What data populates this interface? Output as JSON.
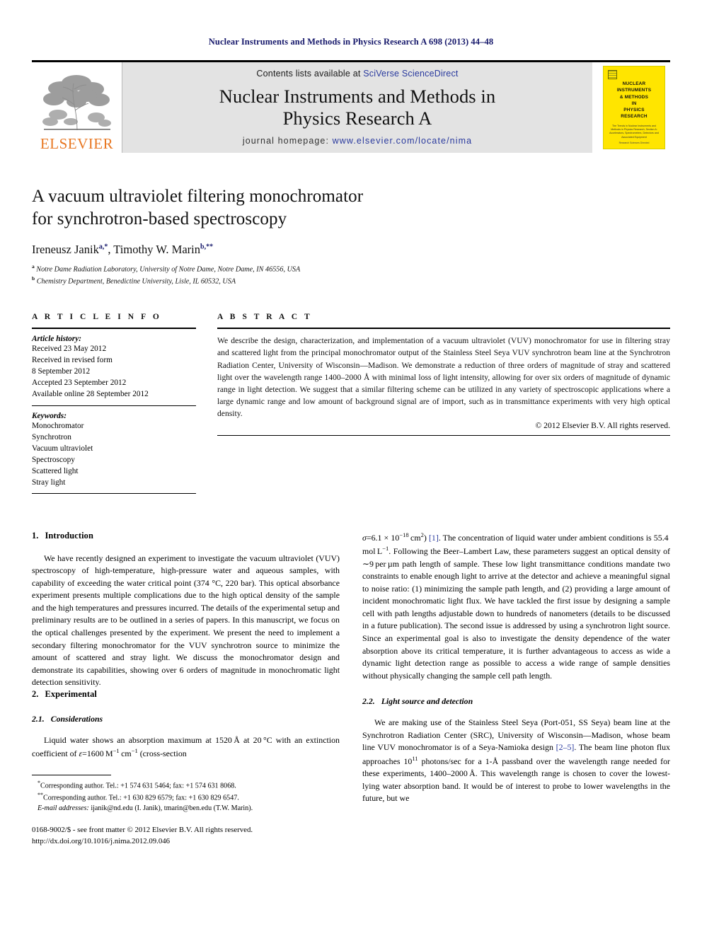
{
  "running_head": "Nuclear Instruments and Methods in Physics Research A 698 (2013) 44–48",
  "masthead": {
    "publisher_name": "ELSEVIER",
    "contents_prefix": "Contents lists available at ",
    "contents_link": "SciVerse ScienceDirect",
    "journal_title_line1": "Nuclear Instruments and Methods in",
    "journal_title_line2": "Physics Research A",
    "homepage_prefix": "journal homepage: ",
    "homepage_link": "www.elsevier.com/locate/nima",
    "cover": {
      "title_lines": [
        "NUCLEAR",
        "INSTRUMENTS",
        "& METHODS",
        "IN",
        "PHYSICS",
        "RESEARCH"
      ],
      "subtitle": "The Trends in Nuclear Instruments and Methods in Physics Research, Section A: Accelerators, Spectrometers, Detectors and Associated Equipment",
      "footer": "Research Sciences Directed"
    }
  },
  "article": {
    "title_line1": "A vacuum ultraviolet filtering monochromator",
    "title_line2": "for synchrotron-based spectroscopy",
    "authors_html": "Ireneusz Janik<sup>a,*</sup>, Timothy W. Marin<sup>b,**</sup>",
    "affiliation_a_marker": "a",
    "affiliation_a": "Notre Dame Radiation Laboratory, University of Notre Dame, Notre Dame, IN 46556, USA",
    "affiliation_b_marker": "b",
    "affiliation_b": "Chemistry Department, Benedictine University, Lisle, IL 60532, USA"
  },
  "article_info": {
    "heading": "A R T I C L E   I N F O",
    "history_label": "Article history:",
    "history": [
      "Received 23 May 2012",
      "Received in revised form",
      "8 September 2012",
      "Accepted 23 September 2012",
      "Available online 28 September 2012"
    ],
    "keywords_label": "Keywords:",
    "keywords": [
      "Monochromator",
      "Synchrotron",
      "Vacuum ultraviolet",
      "Spectroscopy",
      "Scattered light",
      "Stray light"
    ]
  },
  "abstract": {
    "heading": "A B S T R A C T",
    "text": "We describe the design, characterization, and implementation of a vacuum ultraviolet (VUV) monochromator for use in filtering stray and scattered light from the principal monochromator output of the Stainless Steel Seya VUV synchrotron beam line at the Synchrotron Radiation Center, University of Wisconsin—Madison. We demonstrate a reduction of three orders of magnitude of stray and scattered light over the wavelength range 1400–2000 Å with minimal loss of light intensity, allowing for over six orders of magnitude of dynamic range in light detection. We suggest that a similar filtering scheme can be utilized in any variety of spectroscopic applications where a large dynamic range and low amount of background signal are of import, such as in transmittance experiments with very high optical density.",
    "copyright": "© 2012 Elsevier B.V. All rights reserved."
  },
  "sections": {
    "intro_num": "1.",
    "intro_title": "Introduction",
    "intro_para": "We have recently designed an experiment to investigate the vacuum ultraviolet (VUV) spectroscopy of high-temperature, high-pressure water and aqueous samples, with capability of exceeding the water critical point (374 °C, 220 bar). This optical absorbance experiment presents multiple complications due to the high optical density of the sample and the high temperatures and pressures incurred. The details of the experimental setup and preliminary results are to be outlined in a series of papers. In this manuscript, we focus on the optical challenges presented by the experiment. We present the need to implement a secondary filtering monochromator for the VUV synchrotron source to minimize the amount of scattered and stray light. We discuss the monochromator design and demonstrate its capabilities, showing over 6 orders of magnitude in monochromatic light detection sensitivity.",
    "exp_num": "2.",
    "exp_title": "Experimental",
    "cons_num": "2.1.",
    "cons_title": "Considerations",
    "light_num": "2.2.",
    "light_title": "Light source and detection"
  },
  "footnotes": {
    "fn1": "Corresponding author. Tel.: +1 574 631 5464; fax: +1 574 631 8068.",
    "fn1_marker": "*",
    "fn2": "Corresponding author. Tel.: +1 630 829 6579; fax: +1 630 829 6547.",
    "fn2_marker": "**",
    "email_label": "E-mail addresses:",
    "email_text": "ijanik@nd.edu (I. Janik), tmarin@ben.edu (T.W. Marin).",
    "imprint_line1": "0168-9002/$ - see front matter © 2012 Elsevier B.V. All rights reserved.",
    "imprint_line2": "http://dx.doi.org/10.1016/j.nima.2012.09.046"
  },
  "colors": {
    "running_head": "#16186b",
    "link": "#2a3a9e",
    "elsevier_orange": "#E87722",
    "cover_yellow": "#ffe500",
    "masthead_gray": "#e3e3e3"
  }
}
